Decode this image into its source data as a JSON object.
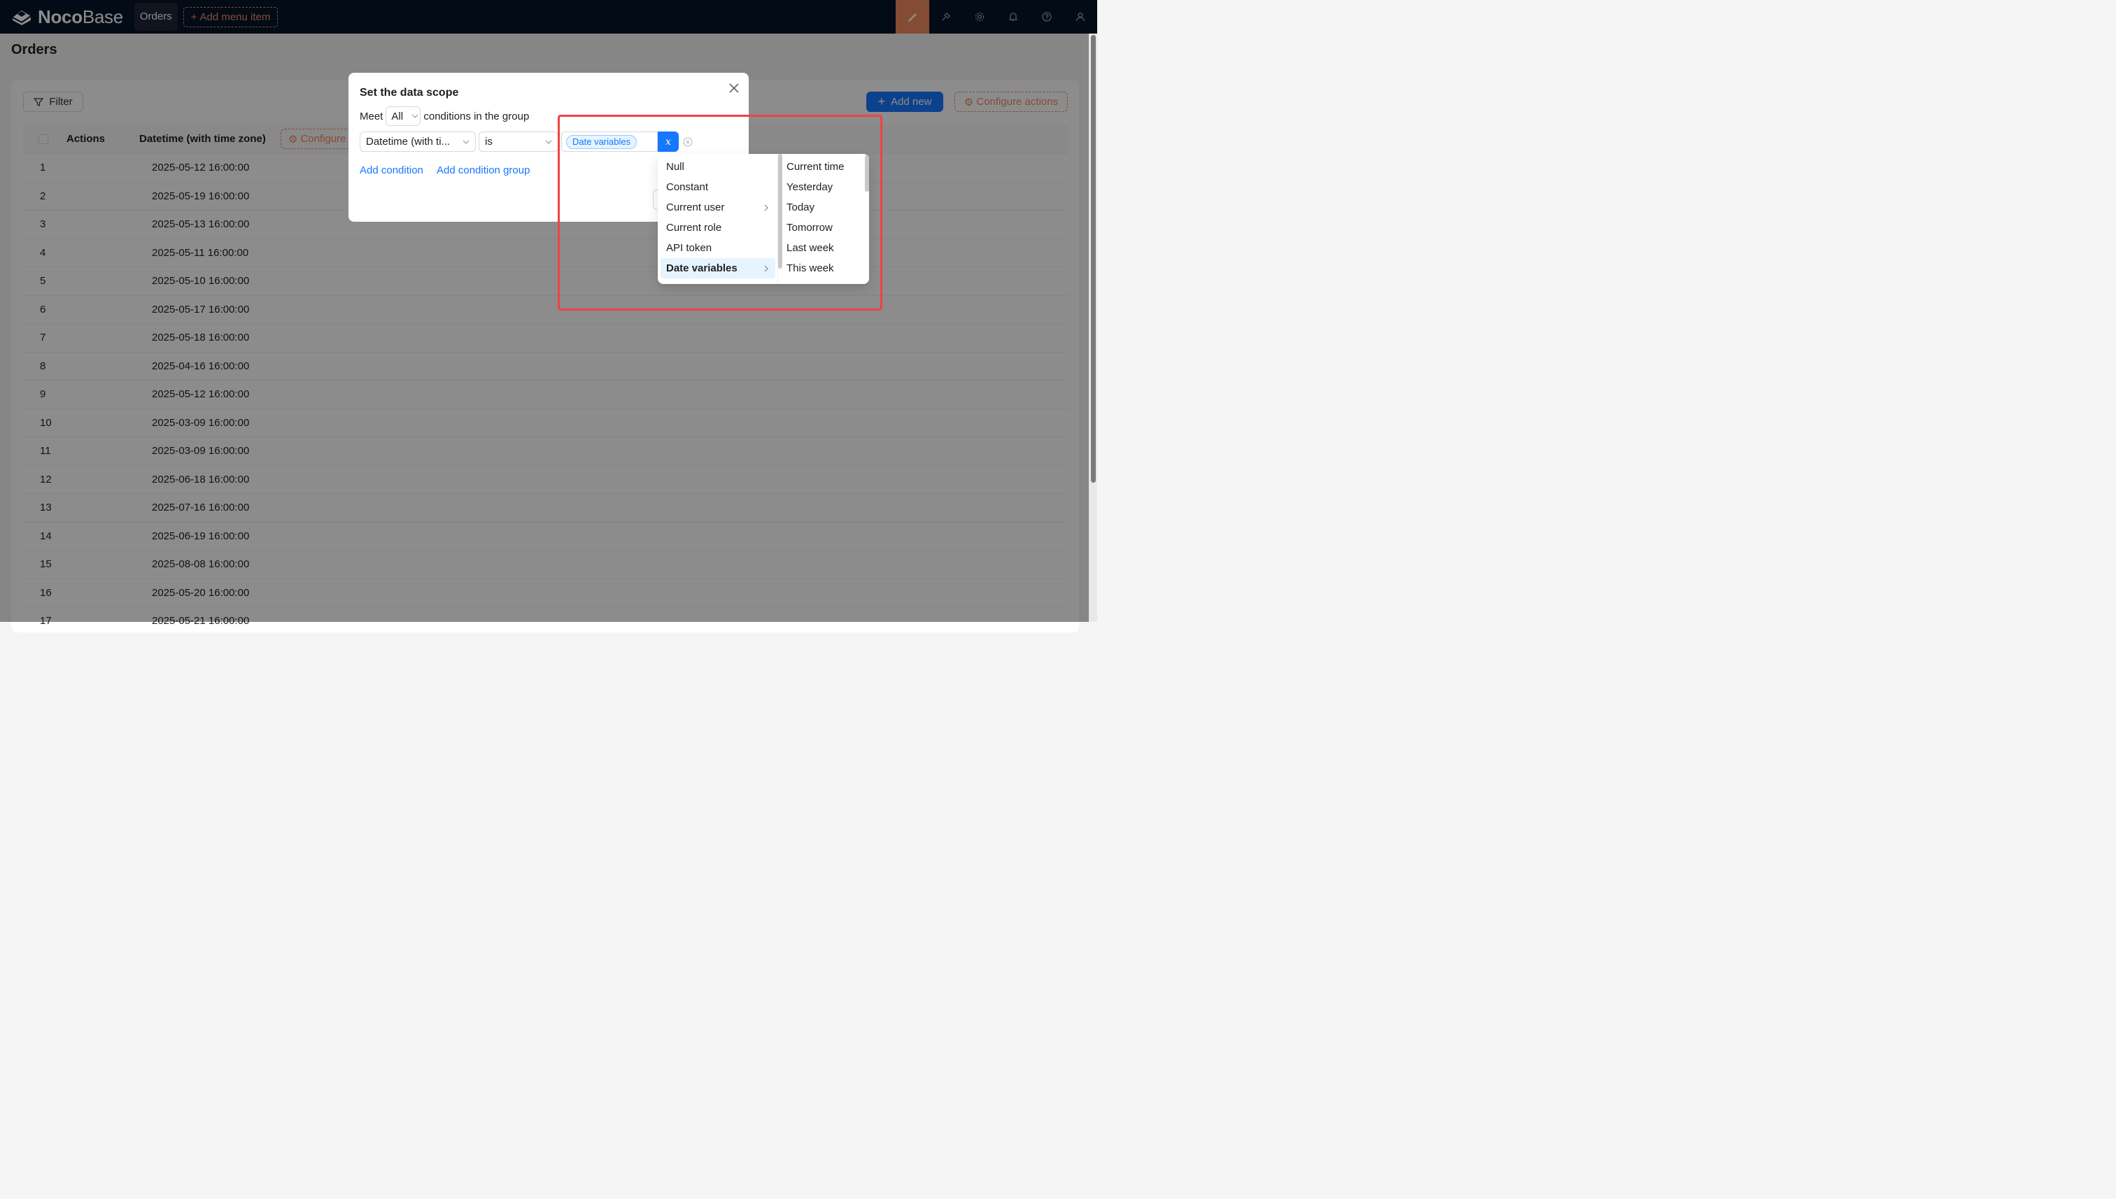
{
  "brand": {
    "name_bold": "Noco",
    "name_light": "Base"
  },
  "topnav": {
    "active_item": "Orders",
    "add_menu_label": "Add menu item",
    "icons": [
      "ui-editor-icon",
      "plugin-icon",
      "settings-icon",
      "bell-icon",
      "help-icon",
      "user-icon"
    ]
  },
  "page": {
    "title": "Orders"
  },
  "toolbar": {
    "filter_label": "Filter",
    "add_new_label": "Add new",
    "configure_actions_label": "Configure actions"
  },
  "table": {
    "columns": [
      "Actions",
      "Datetime (with time zone)"
    ],
    "configure_columns_label": "Configure columns",
    "rows": [
      {
        "index": "1",
        "datetime": "2025-05-12 16:00:00"
      },
      {
        "index": "2",
        "datetime": "2025-05-19 16:00:00"
      },
      {
        "index": "3",
        "datetime": "2025-05-13 16:00:00"
      },
      {
        "index": "4",
        "datetime": "2025-05-11 16:00:00"
      },
      {
        "index": "5",
        "datetime": "2025-05-10 16:00:00"
      },
      {
        "index": "6",
        "datetime": "2025-05-17 16:00:00"
      },
      {
        "index": "7",
        "datetime": "2025-05-18 16:00:00"
      },
      {
        "index": "8",
        "datetime": "2025-04-16 16:00:00"
      },
      {
        "index": "9",
        "datetime": "2025-05-12 16:00:00"
      },
      {
        "index": "10",
        "datetime": "2025-03-09 16:00:00"
      },
      {
        "index": "11",
        "datetime": "2025-03-09 16:00:00"
      },
      {
        "index": "12",
        "datetime": "2025-06-18 16:00:00"
      },
      {
        "index": "13",
        "datetime": "2025-07-16 16:00:00"
      },
      {
        "index": "14",
        "datetime": "2025-06-19 16:00:00"
      },
      {
        "index": "15",
        "datetime": "2025-08-08 16:00:00"
      },
      {
        "index": "16",
        "datetime": "2025-05-20 16:00:00"
      },
      {
        "index": "17",
        "datetime": "2025-05-21 16:00:00"
      }
    ]
  },
  "modal": {
    "title": "Set the data scope",
    "meet_prefix": "Meet",
    "meet_value": "All",
    "meet_suffix": "conditions in the group",
    "condition": {
      "field": "Datetime (with ti...",
      "operator": "is",
      "value_tag": "Date variables",
      "variable_button": "x"
    },
    "add_condition": "Add condition",
    "add_condition_group": "Add condition group"
  },
  "cascader": {
    "level1": [
      {
        "label": "Null",
        "has_children": false
      },
      {
        "label": "Constant",
        "has_children": false
      },
      {
        "label": "Current user",
        "has_children": true
      },
      {
        "label": "Current role",
        "has_children": false
      },
      {
        "label": "API token",
        "has_children": false
      },
      {
        "label": "Date variables",
        "has_children": true,
        "selected": true
      }
    ],
    "level2": [
      "Current time",
      "Yesterday",
      "Today",
      "Tomorrow",
      "Last week",
      "This week"
    ]
  },
  "colors": {
    "header_bg": "#051428",
    "accent_orange": "#f18b62",
    "primary_blue": "#1677ff",
    "highlight_red": "#ef4444"
  }
}
